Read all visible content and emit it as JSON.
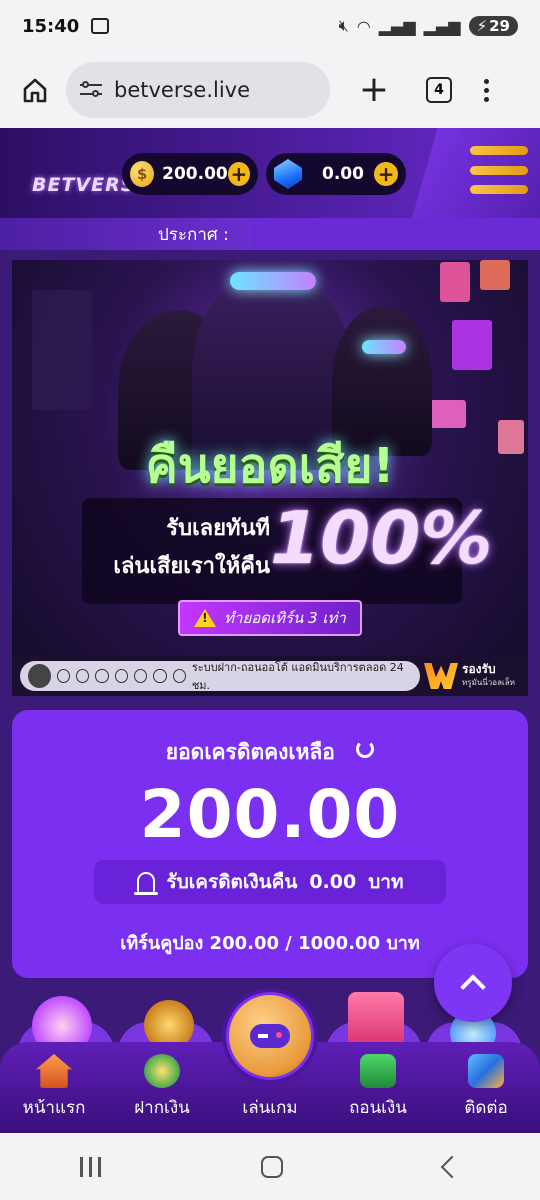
{
  "status_bar": {
    "time": "15:40",
    "battery": "29"
  },
  "browser": {
    "url": "betverse.live",
    "tab_count": "4"
  },
  "header": {
    "logo_text": "BETVERSE",
    "coin_balance": "200.00",
    "gem_balance": "0.00"
  },
  "notice": {
    "label": "ประกาศ :"
  },
  "banner": {
    "headline": "คืนยอดเสีย!",
    "line1": "รับเลยทันที",
    "line2": "เล่นเสียเราให้คืน",
    "percent": "100%",
    "turnover": "ทำยอดเทิร์น 3 เท่า",
    "footer_text": "ระบบฝาก-ถอนออโต้ แอดมินบริการตลอด 24 ชม.",
    "partner_line1": "รองรับ",
    "partner_line2": "ทรูมันนี่วอลเล็ท"
  },
  "credit": {
    "title": "ยอดเครดิตคงเหลือ",
    "amount": "200.00",
    "cashback_label": "รับเครดิตเงินคืน",
    "cashback_value": "0.00",
    "cashback_unit": "บาท",
    "coupon_line": "เทิร์นคูปอง 200.00 / 1000.00 บาท"
  },
  "bottom_nav": {
    "items": [
      {
        "label": "หน้าแรก",
        "icon": "house-icon"
      },
      {
        "label": "ฝากเงิน",
        "icon": "deposit-icon"
      },
      {
        "label": "เล่นเกม",
        "icon": "gamepad-icon"
      },
      {
        "label": "ถอนเงิน",
        "icon": "withdraw-icon"
      },
      {
        "label": "ติดต่อ",
        "icon": "contact-icon"
      }
    ]
  },
  "colors": {
    "card_purple": "#7b2ff0",
    "gold": "#f1b81b",
    "site_bg": "#3b1a78"
  }
}
